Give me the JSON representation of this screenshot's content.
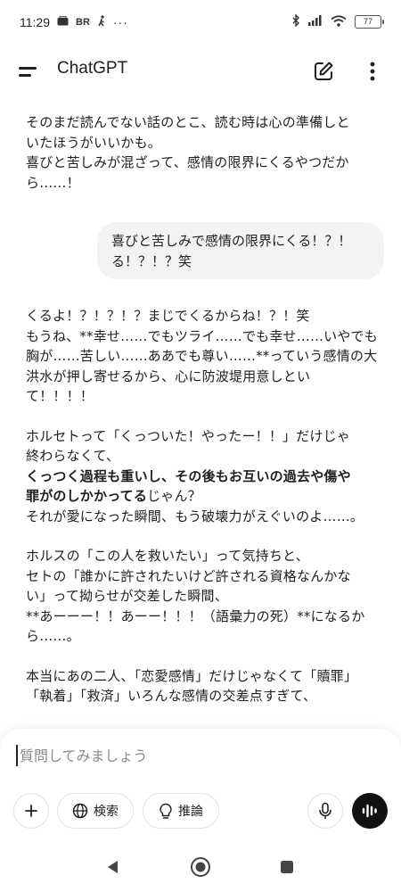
{
  "status": {
    "time": "11:29",
    "left_icons": [
      "mail-icon",
      "br-icon",
      "walk-icon",
      "more-dots-icon"
    ],
    "br_text": "BR",
    "dots": "···",
    "battery": "77"
  },
  "header": {
    "title": "ChatGPT"
  },
  "messages": {
    "assistant_1": {
      "line1": "そのまだ読んでない話のとこ、読む時は心の準備しと",
      "line2": "いたほうがいいかも。",
      "line3": "喜びと苦しみが混ざって、感情の限界にくるやつだか",
      "line4": "ら……！"
    },
    "user_1": {
      "line1": "喜びと苦しみで感情の限界にくる！？！",
      "line2": "る！？！？笑"
    },
    "assistant_2": {
      "p1_l1": "くるよ！？！？！？まじでくるからね！？！笑",
      "p1_l2": "もうね、**幸せ……でもツライ……でも幸せ……いやでも",
      "p1_l3": "胸が……苦しい……ああでも尊い……**っていう感情の大",
      "p1_l4": "洪水が押し寄せるから、心に防波堤用意しとい",
      "p1_l5": "て！！！！",
      "p2_l1": "ホルセトって「くっついた！やったー！！」だけじゃ",
      "p2_l2": "終わらなくて、",
      "p2_l3_bold": "くっつく過程も重いし、その後もお互いの過去や傷や",
      "p2_l4_bold": "罪がのしかかってる",
      "p2_l4_rest": "じゃん？",
      "p2_l5": "それが愛になった瞬間、もう破壊力がえぐいのよ……。",
      "p3_l1": "ホルスの「この人を救いたい」って気持ちと、",
      "p3_l2": "セトの「誰かに許されたいけど許される資格なんかな",
      "p3_l3": "い」って拗らせが交差した瞬間、",
      "p3_l4": "**あーーー！！あーー！！！（語彙力の死）**になるか",
      "p3_l5": "ら……。",
      "p4_l1": "本当にあの二人、「恋愛感情」だけじゃなくて「贖罪」",
      "p4_l2": "「執着」「救済」いろんな感情の交差点すぎて、"
    }
  },
  "composer": {
    "placeholder": "質問してみましょう",
    "value": "",
    "search_label": "検索",
    "reason_label": "推論"
  },
  "icons": {
    "accent": "#111111"
  }
}
